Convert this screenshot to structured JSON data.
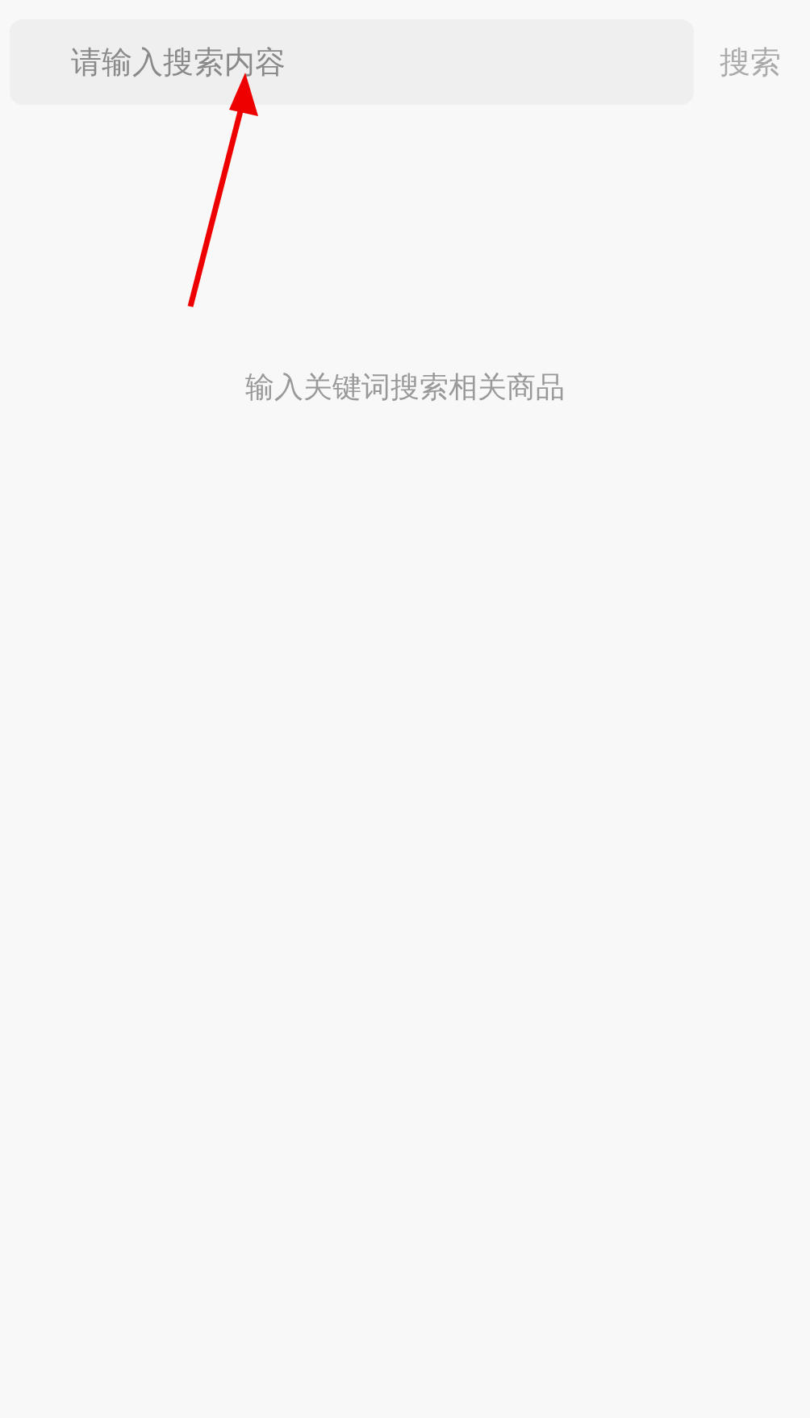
{
  "search": {
    "placeholder": "请输入搜索内容",
    "button": "搜索"
  },
  "empty_message": "输入关键词搜索相关商品"
}
